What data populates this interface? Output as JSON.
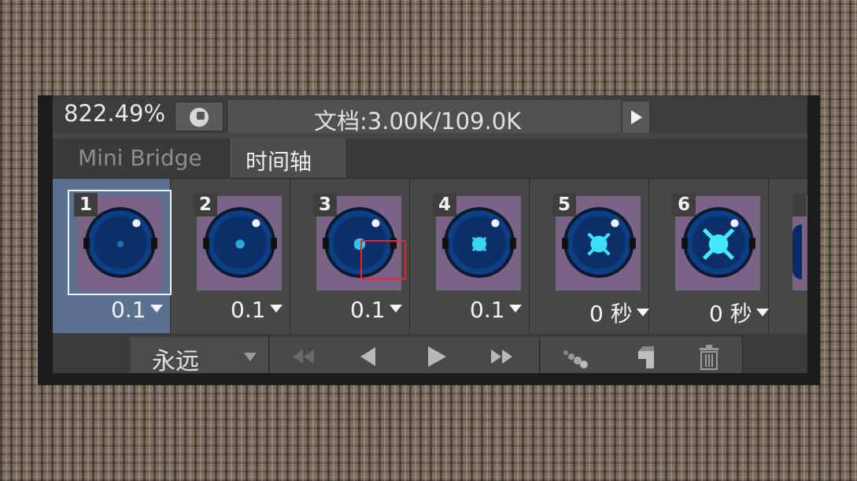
{
  "status_bar": {
    "zoom": "822.49%",
    "doc_info": "文档:3.00K/109.0K"
  },
  "tabs": [
    {
      "label": "Mini Bridge",
      "active": false
    },
    {
      "label": "时间轴",
      "active": true
    }
  ],
  "frames": [
    {
      "number": "1",
      "delay": "0.1",
      "selected": true
    },
    {
      "number": "2",
      "delay": "0.1",
      "selected": false
    },
    {
      "number": "3",
      "delay": "0.1",
      "selected": false
    },
    {
      "number": "4",
      "delay": "0.1",
      "selected": false
    },
    {
      "number": "5",
      "delay": "0 秒",
      "selected": false
    },
    {
      "number": "6",
      "delay": "0 秒",
      "selected": false
    }
  ],
  "controls": {
    "loop_option": "永远"
  },
  "colors": {
    "selected_frame": "#5b7192",
    "thumb_bg": "#7a6384",
    "orb_blue": "#0d3f86",
    "highlight": "#e02a2a"
  },
  "icons": [
    "zoom-options-icon",
    "status-menu-arrow-icon",
    "first-frame-icon",
    "previous-frame-icon",
    "play-icon",
    "next-frame-icon",
    "tween-icon",
    "duplicate-frame-icon",
    "trash-icon"
  ]
}
